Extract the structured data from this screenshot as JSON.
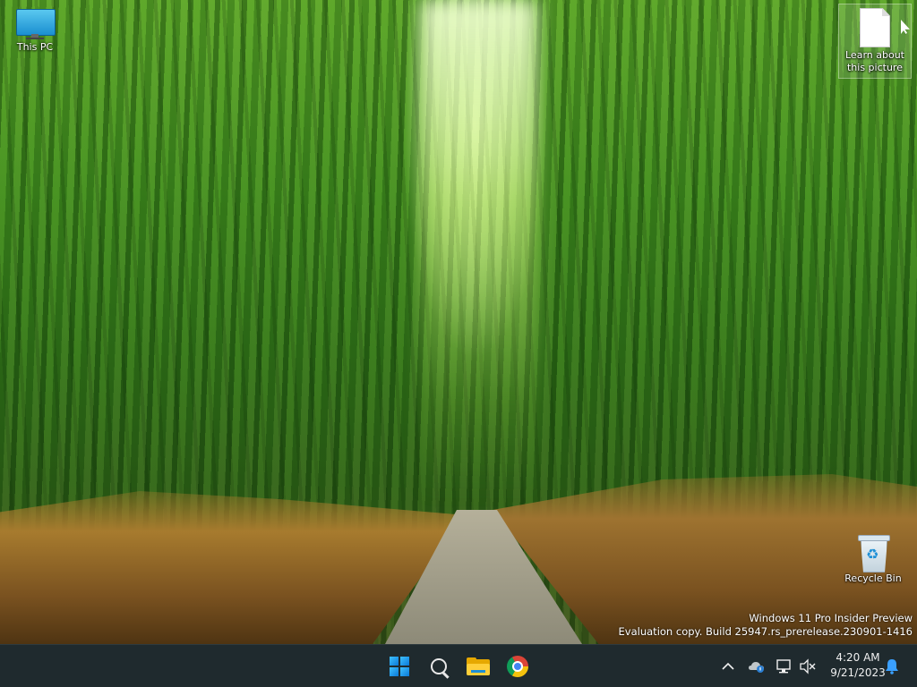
{
  "desktop": {
    "icons": [
      {
        "label": "This PC",
        "icon": "computer-icon"
      },
      {
        "label_line1": "Learn about",
        "label_line2": "this picture",
        "icon": "document-icon"
      },
      {
        "label": "Recycle Bin",
        "icon": "recycle-bin-icon"
      }
    ],
    "watermark": {
      "line1": "Windows 11 Pro Insider Preview",
      "line2": "Evaluation copy. Build 25947.rs_prerelease.230901-1416"
    }
  },
  "taskbar": {
    "apps": [
      {
        "name": "Start",
        "icon": "windows-logo-icon"
      },
      {
        "name": "Search",
        "icon": "search-icon"
      },
      {
        "name": "File Explorer",
        "icon": "folder-icon"
      },
      {
        "name": "Google Chrome",
        "icon": "chrome-icon"
      }
    ],
    "tray": {
      "overflow_glyph": "^",
      "icons": [
        "chevron-up-icon",
        "onedrive-icon",
        "network-icon",
        "volume-muted-icon"
      ],
      "time": "4:20 AM",
      "date": "9/21/2023"
    },
    "colors": {
      "background": "#1f2a2e",
      "accent": "#0a79d8"
    }
  }
}
